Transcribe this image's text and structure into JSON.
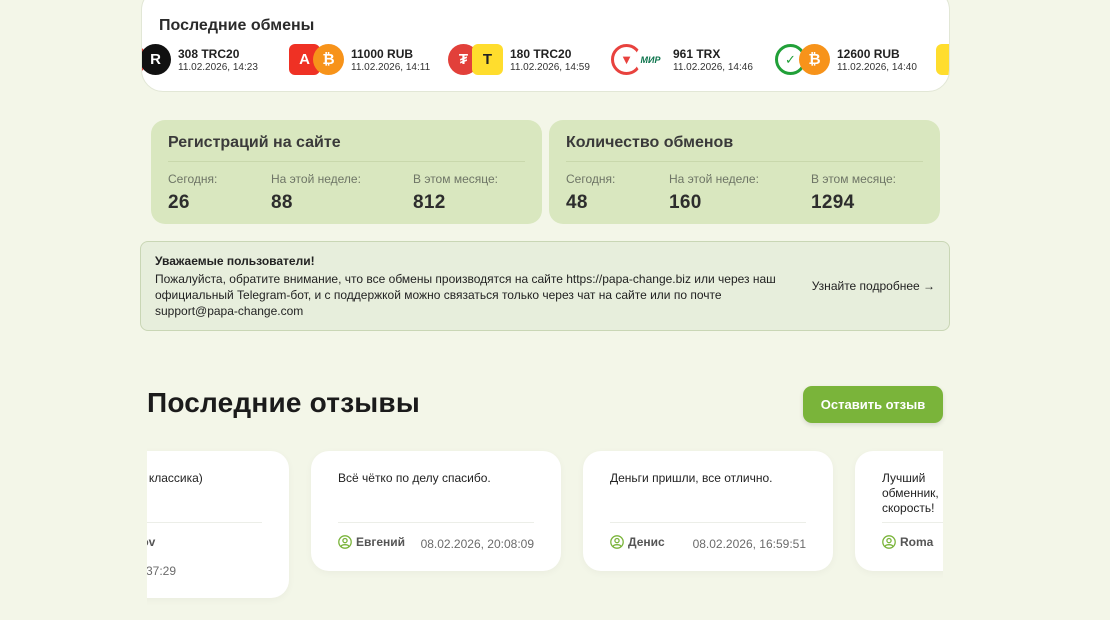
{
  "exchanges": {
    "title": "Последние обмены",
    "items": [
      {
        "amount": "308 TRC20",
        "time": "11.02.2026, 14:23",
        "from_icon": "tether-icon",
        "to_icon": "raiffeisen-icon",
        "from_color": "#e2403a",
        "to_color": "#111111"
      },
      {
        "amount": "11000 RUB",
        "time": "11.02.2026, 14:11",
        "from_icon": "alfa-bank-icon",
        "to_icon": "bitcoin-icon",
        "from_color": "#ef3124",
        "to_color": "#f7931a"
      },
      {
        "amount": "180 TRC20",
        "time": "11.02.2026, 14:59",
        "from_icon": "tether-icon",
        "to_icon": "tbank-icon",
        "from_color": "#e2403a",
        "to_color": "#ffdd2d"
      },
      {
        "amount": "961 TRX",
        "time": "11.02.2026, 14:46",
        "from_icon": "tron-icon",
        "to_icon": "mir-icon",
        "from_color": "#e8423e",
        "to_color": "#0f754e"
      },
      {
        "amount": "12600 RUB",
        "time": "11.02.2026, 14:40",
        "from_icon": "sber-icon",
        "to_icon": "bitcoin-icon",
        "from_color": "#21a038",
        "to_color": "#f7931a"
      }
    ]
  },
  "stats": {
    "registrations": {
      "title": "Регистраций на сайте",
      "today_label": "Сегодня:",
      "today": "26",
      "week_label": "На этой неделе:",
      "week": "88",
      "month_label": "В этом месяце:",
      "month": "812"
    },
    "exchanges": {
      "title": "Количество обменов",
      "today_label": "Сегодня:",
      "today": "48",
      "week_label": "На этой неделе:",
      "week": "160",
      "month_label": "В этом месяце:",
      "month": "1294"
    }
  },
  "notice": {
    "title": "Уважаемые пользователи!",
    "text": "Пожалуйста, обратите внимание, что все обмены производятся на сайте https://papa-change.biz или через наш официальный Telegram-бот, и с поддержкой можно связаться только через чат на сайте или по почте support@papa-change.com",
    "link": "Узнайте подробнее →"
  },
  "reviews": {
    "title": "Последние отзывы",
    "button": "Оставить отзыв",
    "items": [
      {
        "text": "я классика)",
        "author": "nov",
        "date": "37:29"
      },
      {
        "text": "Всё чётко по делу спасибо.",
        "author": "Евгений",
        "date": "08.02.2026, 20:08:09"
      },
      {
        "text": "Деньги пришли, все отлично.",
        "author": "Денис",
        "date": "08.02.2026, 16:59:51"
      },
      {
        "text": "Лучший обменник, скорость!",
        "author": "Roma",
        "date": ""
      }
    ]
  },
  "colors": {
    "page_bg": "#f3f6e8",
    "stat_card": "#d9e7bf",
    "accent": "#7ab43a",
    "notice_bg": "#e7eedc"
  }
}
